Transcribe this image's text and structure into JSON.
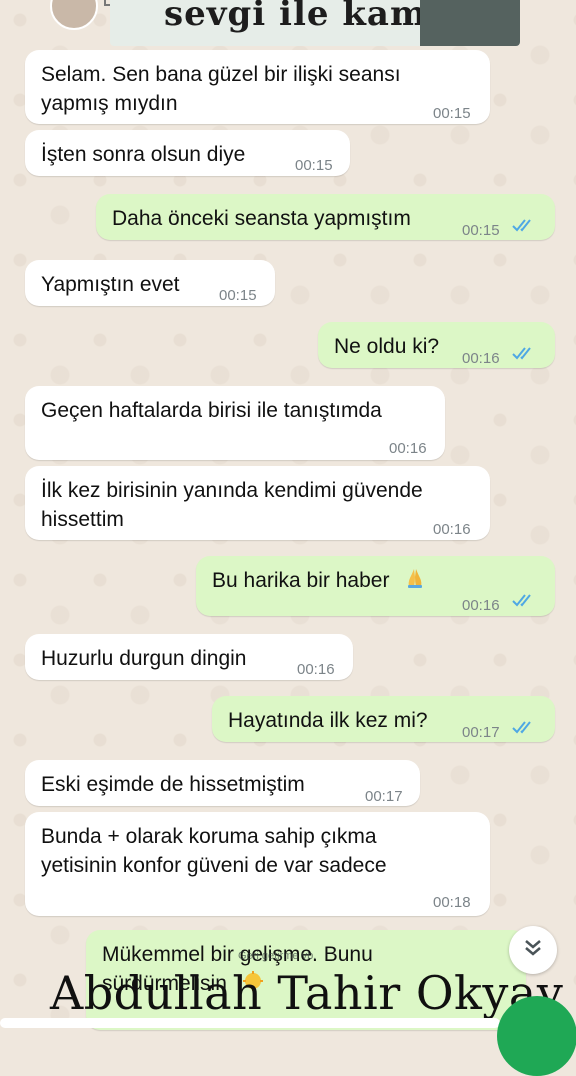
{
  "header": {
    "banner_text": "sevgi ile kam..."
  },
  "messages": [
    {
      "dir": "in",
      "line1": "Selam. Sen bana güzel bir ilişki seansı",
      "line2": "yapmış mıydın",
      "time": "00:15"
    },
    {
      "dir": "in",
      "line1": "İşten sonra olsun diye",
      "time": "00:15"
    },
    {
      "dir": "out",
      "line1": "Daha önceki seansta yapmıştım",
      "time": "00:15",
      "read": true
    },
    {
      "dir": "in",
      "line1": "Yapmıştın evet",
      "time": "00:15"
    },
    {
      "dir": "out",
      "line1": "Ne oldu ki?",
      "time": "00:16",
      "read": true
    },
    {
      "dir": "in",
      "line1": "Geçen haftalarda birisi ile tanıştımda",
      "time": "00:16"
    },
    {
      "dir": "in",
      "line1": "İlk kez birisinin yanında kendimi güvende",
      "line2": "hissettim",
      "time": "00:16"
    },
    {
      "dir": "out",
      "line1": "Bu harika bir haber",
      "emoji": "folded-hands-icon",
      "time": "00:16",
      "read": true
    },
    {
      "dir": "in",
      "line1": "Huzurlu durgun dingin",
      "time": "00:16"
    },
    {
      "dir": "out",
      "line1": "Hayatında ilk kez mi?",
      "time": "00:17",
      "read": true
    },
    {
      "dir": "in",
      "line1": "Eski eşimde de hissetmiştim",
      "time": "00:17"
    },
    {
      "dir": "in",
      "line1": "Bunda + olarak koruma sahip çıkma",
      "line2": "yetisinin konfor güveni de var sadece",
      "time": "00:18"
    },
    {
      "dir": "out",
      "line1": "Mükemmel bir gelişme. Bunu",
      "line2": "sürdürmelisin",
      "emoji": "sun-face-icon"
    }
  ],
  "overlay_small_text": "Geri getirme vb.",
  "watermark": "Abdullah Tahir Okyay",
  "colors": {
    "incoming": "#ffffff",
    "outgoing": "#dcf7c6",
    "read_ticks": "#4fa8e4",
    "fab": "#1fa855"
  },
  "icons": {
    "scroll_down": "double-chevron-down-icon",
    "read_receipt": "double-check-icon"
  }
}
